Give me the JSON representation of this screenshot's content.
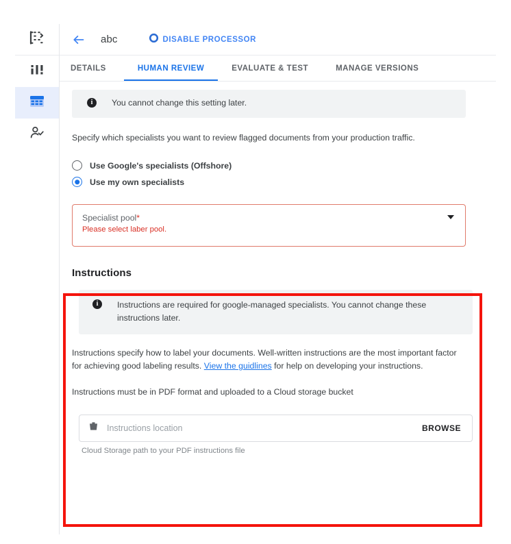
{
  "rail": {
    "items": [
      {
        "name": "processor-overview-icon",
        "icon": "processor-list-icon",
        "active": false
      },
      {
        "name": "dashboard-icon",
        "icon": "bar-chart-icon",
        "active": false
      },
      {
        "name": "processors-table-icon",
        "icon": "table-icon",
        "active": true
      },
      {
        "name": "human-review-icon",
        "icon": "person-check-icon",
        "active": false
      }
    ]
  },
  "topbar": {
    "back_icon": "arrow-left-icon",
    "title": "abc",
    "disable_processor": {
      "icon": "circle-ring-icon",
      "label": "DISABLE PROCESSOR",
      "color": "#4285f4"
    }
  },
  "tabs": [
    {
      "label": "DETAILS",
      "active": false
    },
    {
      "label": "HUMAN REVIEW",
      "active": true
    },
    {
      "label": "EVALUATE & TEST",
      "active": false
    },
    {
      "label": "MANAGE VERSIONS",
      "active": false
    }
  ],
  "human_review": {
    "notice": "You cannot change this setting later.",
    "description": "Specify which specialists you want to review flagged documents from your production traffic.",
    "options": [
      {
        "label": "Use Google's specialists (Offshore)",
        "selected": false
      },
      {
        "label": "Use my own specialists",
        "selected": true
      }
    ],
    "specialist_pool": {
      "label": "Specialist pool",
      "required_marker": "*",
      "value": "",
      "error": "Please select laber pool.",
      "caret_icon": "chevron-down-icon"
    }
  },
  "instructions": {
    "title": "Instructions",
    "notice": "Instructions are required for google-managed specialists. You cannot change these instructions later.",
    "para1_before_link": "Instructions specify how to label your documents. Well-written instructions are the most important factor for achieving good labeling results. ",
    "link_text": "View the guidlines",
    "para1_after_link": " for help on developing your instructions.",
    "para2": "Instructions must be in PDF format and uploaded to a Cloud storage bucket",
    "location_field": {
      "icon": "storage-bucket-icon",
      "placeholder": "Instructions location",
      "value": "",
      "browse_label": "BROWSE",
      "hint": "Cloud Storage path to your PDF instructions file"
    }
  },
  "annotation": {
    "name": "red-highlight-box",
    "color": "#f4140c"
  },
  "colors": {
    "accent_blue": "#1a73e8",
    "error_red": "#d93025",
    "annotation_red": "#f4140c",
    "banner_gray": "#f1f3f4"
  }
}
